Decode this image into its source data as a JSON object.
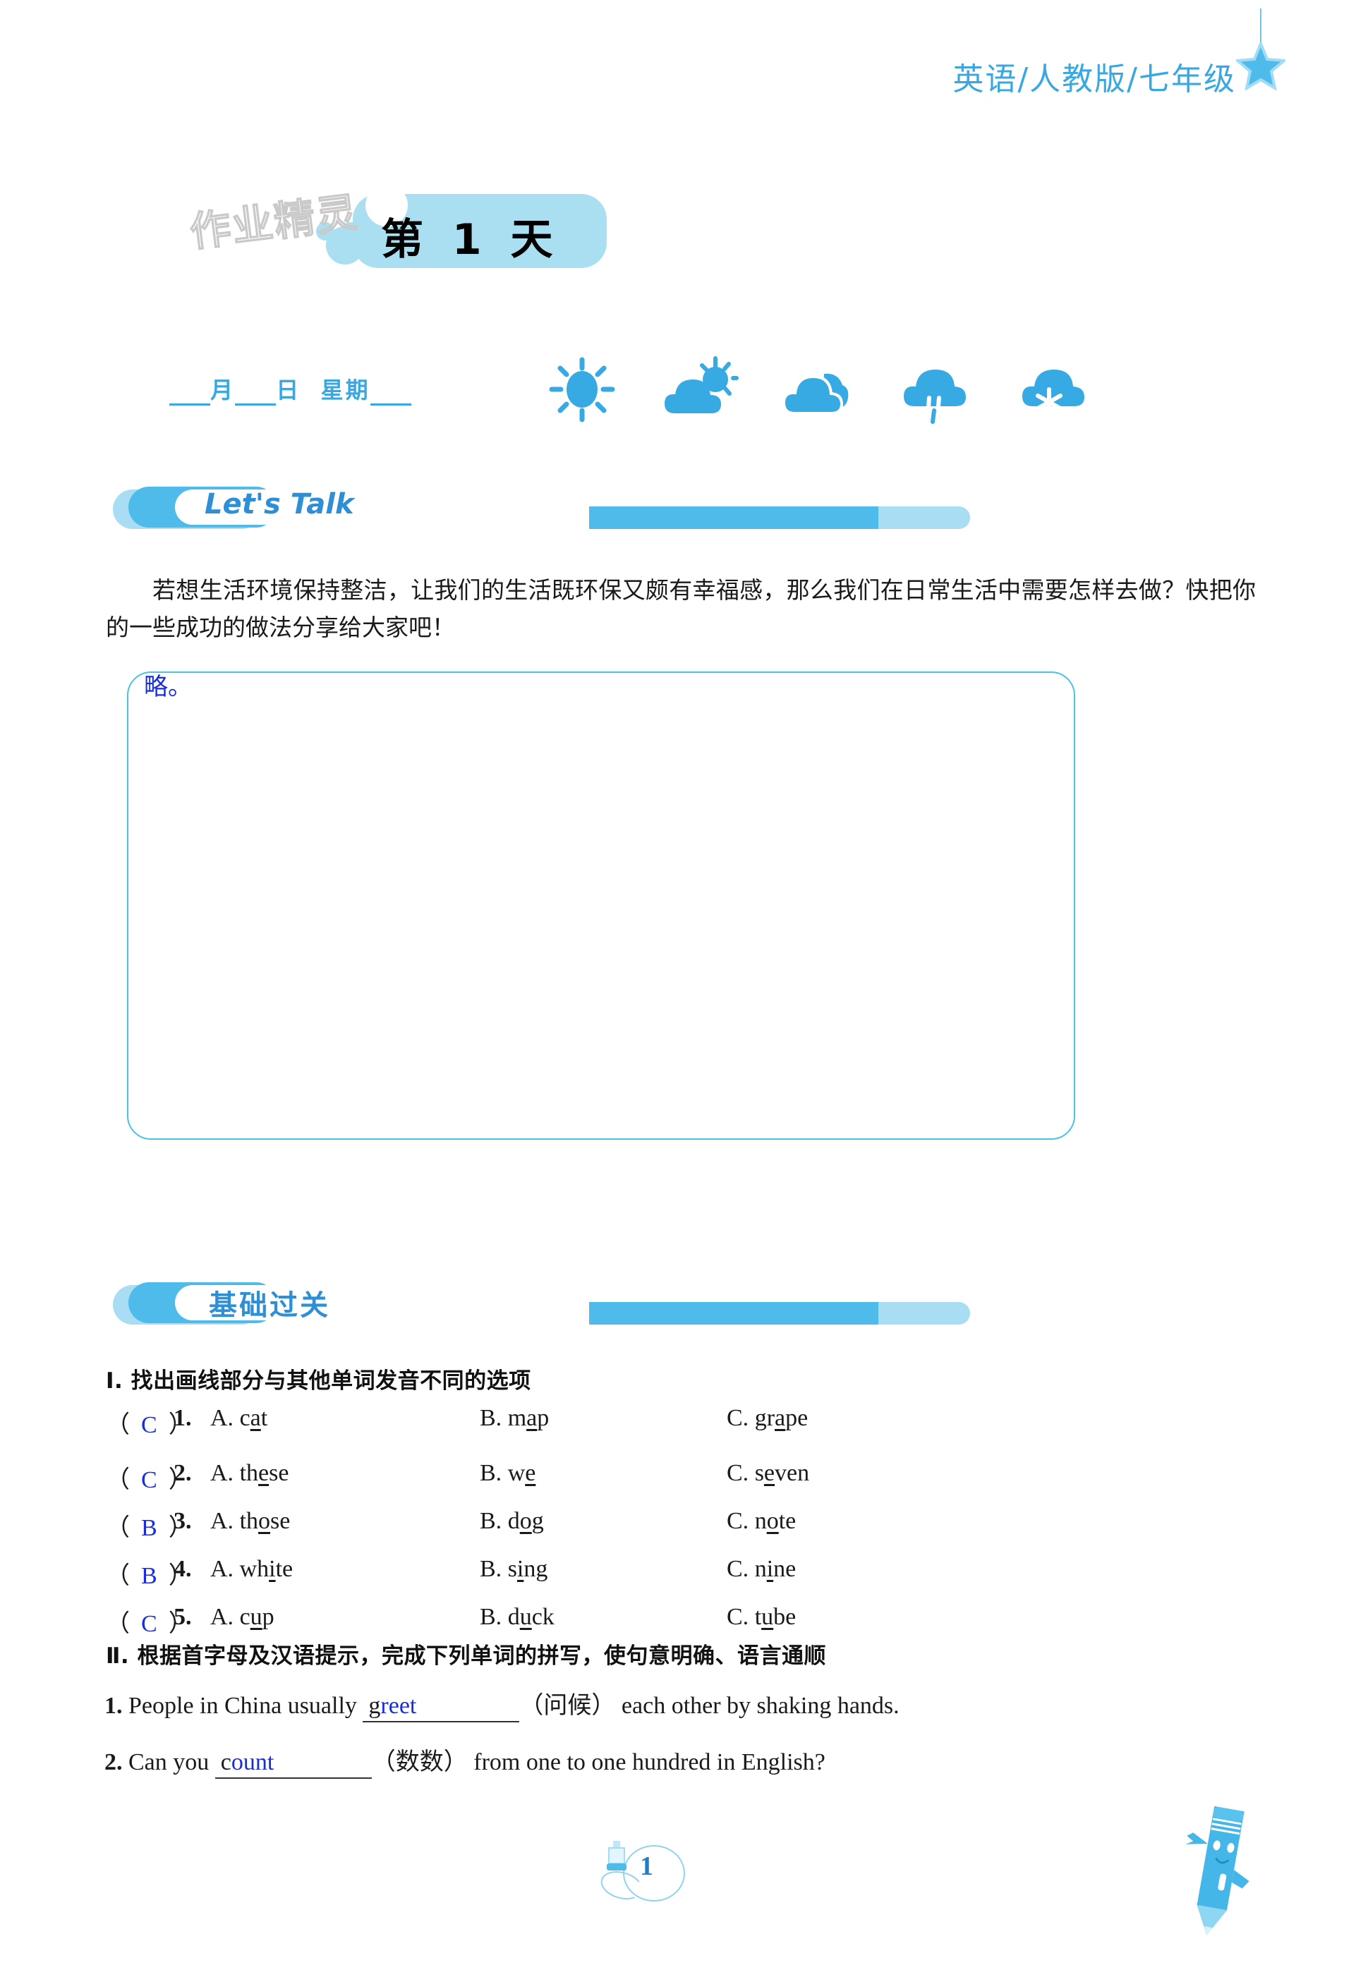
{
  "header": {
    "title": "英语/人教版/七年级",
    "star_icon": "star-icon"
  },
  "day_banner": {
    "title": "第 1 天"
  },
  "watermark": {
    "text": "作业精灵"
  },
  "date_row": {
    "month_label": "月",
    "day_label": "日",
    "weekday_label": "星期",
    "weather_icons": [
      "sunny-icon",
      "partly-cloudy-icon",
      "cloudy-icon",
      "rainy-icon",
      "snowy-icon"
    ]
  },
  "sections": {
    "lets_talk": {
      "label": "Let's Talk",
      "prompt": "若想生活环境保持整洁，让我们的生活既环保又颇有幸福感，那么我们在日常生活中需要怎样去做？快把你的一些成功的做法分享给大家吧！",
      "answer": "略。"
    },
    "basics": {
      "label": "基础过关",
      "part1": {
        "heading": "Ⅰ. 找出画线部分与其他单词发音不同的选项",
        "questions": [
          {
            "num": "1.",
            "answer": "C",
            "options": [
              {
                "letter": "A.",
                "pre": "c",
                "underlined": "a",
                "post": "t"
              },
              {
                "letter": "B.",
                "pre": "m",
                "underlined": "a",
                "post": "p"
              },
              {
                "letter": "C.",
                "pre": "gr",
                "underlined": "a",
                "post": "pe"
              }
            ]
          },
          {
            "num": "2.",
            "answer": "C",
            "options": [
              {
                "letter": "A.",
                "pre": "th",
                "underlined": "e",
                "post": "se"
              },
              {
                "letter": "B.",
                "pre": "w",
                "underlined": "e",
                "post": ""
              },
              {
                "letter": "C.",
                "pre": "s",
                "underlined": "e",
                "post": "ven"
              }
            ]
          },
          {
            "num": "3.",
            "answer": "B",
            "options": [
              {
                "letter": "A.",
                "pre": "th",
                "underlined": "o",
                "post": "se"
              },
              {
                "letter": "B.",
                "pre": "d",
                "underlined": "o",
                "post": "g"
              },
              {
                "letter": "C.",
                "pre": "n",
                "underlined": "o",
                "post": "te"
              }
            ]
          },
          {
            "num": "4.",
            "answer": "B",
            "options": [
              {
                "letter": "A.",
                "pre": "wh",
                "underlined": "i",
                "post": "te"
              },
              {
                "letter": "B.",
                "pre": "s",
                "underlined": "i",
                "post": "ng"
              },
              {
                "letter": "C.",
                "pre": "n",
                "underlined": "i",
                "post": "ne"
              }
            ]
          },
          {
            "num": "5.",
            "answer": "C",
            "options": [
              {
                "letter": "A.",
                "pre": "c",
                "underlined": "u",
                "post": "p"
              },
              {
                "letter": "B.",
                "pre": "d",
                "underlined": "u",
                "post": "ck"
              },
              {
                "letter": "C.",
                "pre": "t",
                "underlined": "u",
                "post": "be"
              }
            ]
          }
        ]
      },
      "part2": {
        "heading": "Ⅱ. 根据首字母及汉语提示，完成下列单词的拼写，使句意明确、语言通顺",
        "questions": [
          {
            "num": "1.",
            "before": "People in China usually",
            "given": "g",
            "fill": "reet",
            "hint": "（问候）",
            "after": "each other by shaking hands."
          },
          {
            "num": "2.",
            "before": "Can you",
            "given": "c",
            "fill": "ount",
            "hint": "（数数）",
            "after": "from one to one hundred in English?"
          }
        ]
      }
    }
  },
  "footer": {
    "page_number": "1",
    "mascot_icon": "pencil-mascot-icon",
    "inkbottle_icon": "ink-bottle-icon"
  },
  "colors": {
    "accent_blue": "#3aa8e0",
    "light_blue": "#a8ddf4",
    "mid_blue": "#4fbbea",
    "answer_blue": "#1a2ed8",
    "box_border": "#49c4e0"
  }
}
